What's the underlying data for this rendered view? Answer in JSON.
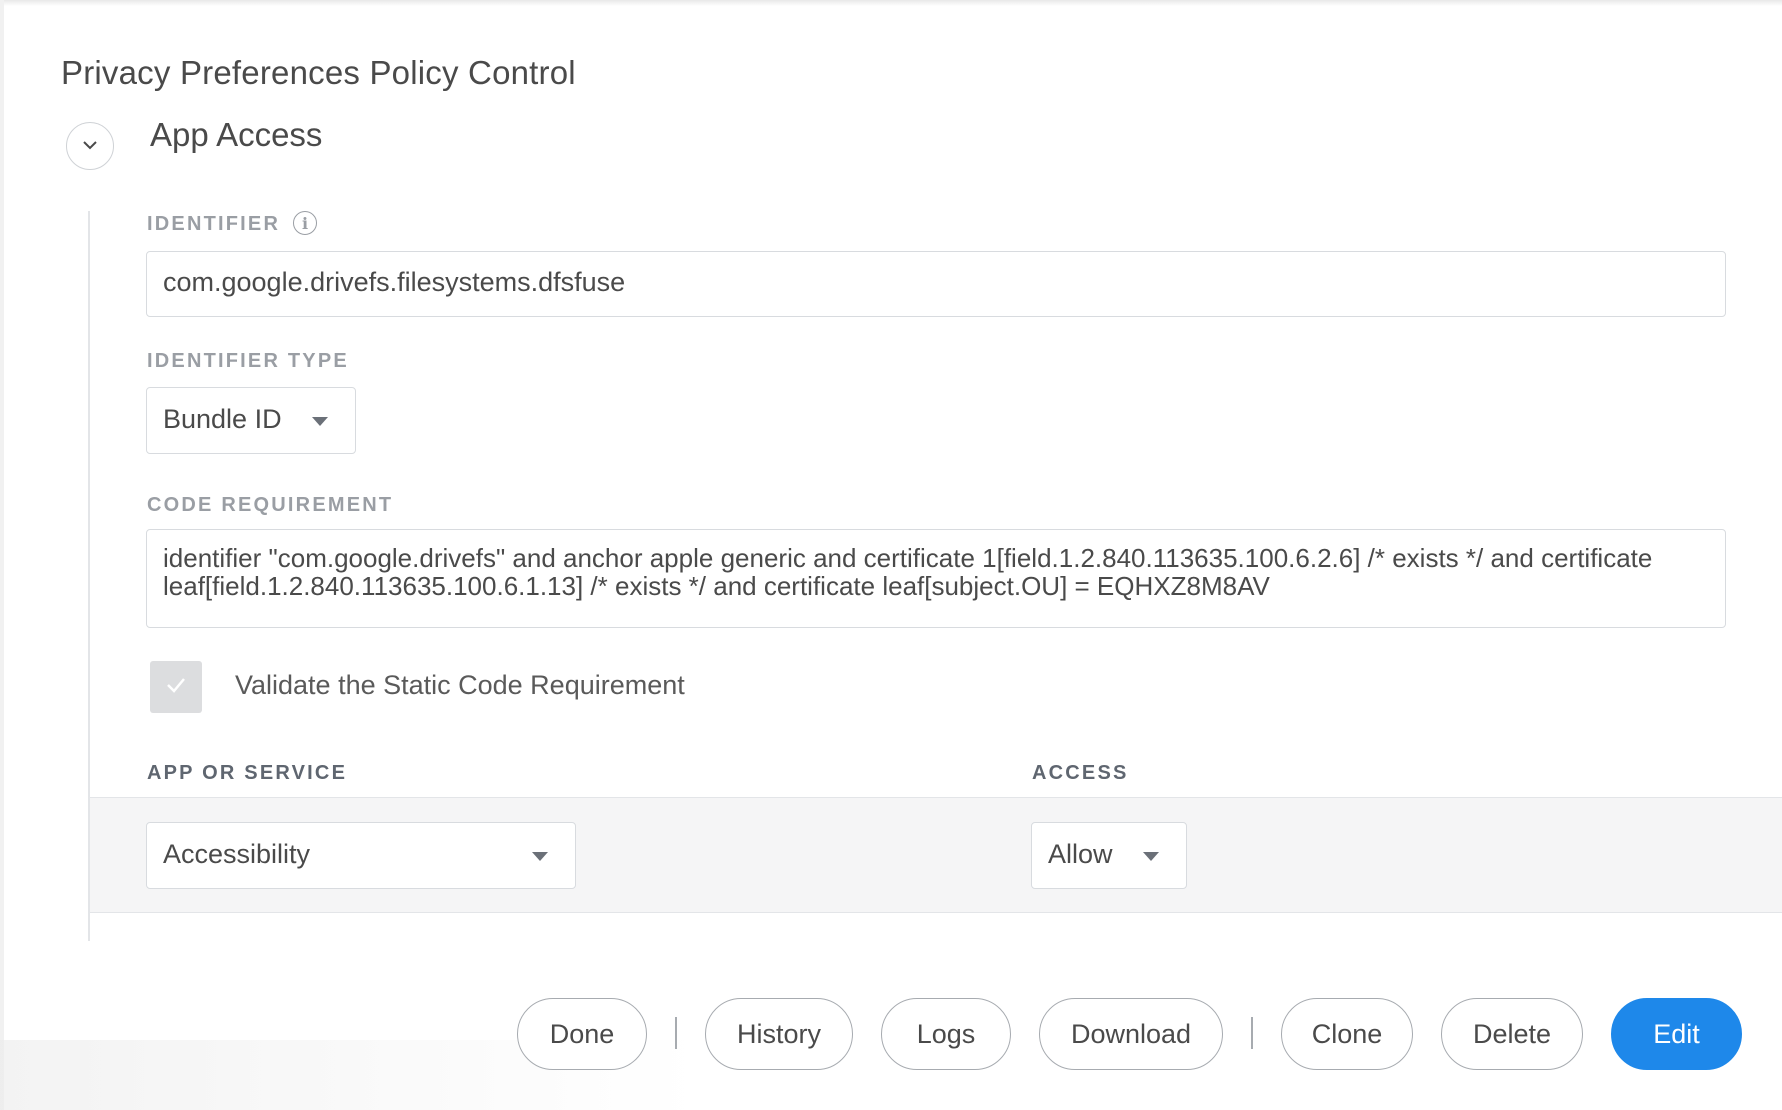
{
  "page": {
    "title": "Privacy Preferences Policy Control"
  },
  "section": {
    "title": "App Access",
    "collapse_icon": "chevron-down-icon"
  },
  "identifier": {
    "label": "IDENTIFIER",
    "info_icon": "info-icon",
    "value": "com.google.drivefs.filesystems.dfsfuse"
  },
  "identifier_type": {
    "label": "IDENTIFIER TYPE",
    "selected": "Bundle ID"
  },
  "code_requirement": {
    "label": "CODE REQUIREMENT",
    "value": "identifier \"com.google.drivefs\" and anchor apple generic and certificate 1[field.1.2.840.113635.100.6.2.6] /* exists */ and certificate leaf[field.1.2.840.113635.100.6.1.13] /* exists */ and certificate leaf[subject.OU] = EQHXZ8M8AV"
  },
  "validate": {
    "label": "Validate the Static Code Requirement",
    "checked": true
  },
  "services_table": {
    "headers": {
      "app_or_service": "APP OR SERVICE",
      "access": "ACCESS"
    },
    "row": {
      "service": "Accessibility",
      "access": "Allow"
    }
  },
  "actions": {
    "done": "Done",
    "history": "History",
    "logs": "Logs",
    "download": "Download",
    "clone": "Clone",
    "delete": "Delete",
    "edit": "Edit"
  },
  "colors": {
    "primary": "#1e88ea",
    "label_gray": "#9a9ea4",
    "header_dark": "#5f6670"
  }
}
